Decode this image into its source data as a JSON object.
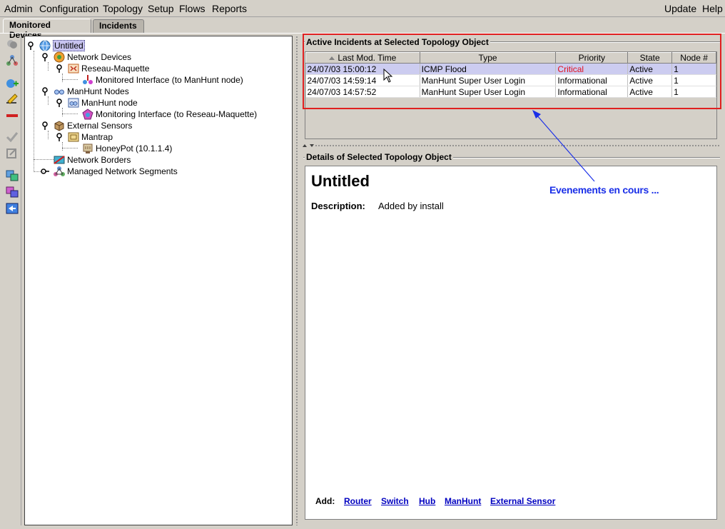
{
  "menubar": {
    "items": [
      "Admin",
      "Configuration",
      "Topology",
      "Setup",
      "Flows",
      "Reports"
    ],
    "right_items": [
      "Update",
      "Help"
    ]
  },
  "tabs": [
    {
      "label": "Monitored Devices",
      "active": true
    },
    {
      "label": "Incidents",
      "active": false
    }
  ],
  "tree": {
    "root": "Untitled",
    "network_devices": "Network Devices",
    "reseau": "Reseau-Maquette",
    "monitored_interface": "Monitored Interface (to ManHunt node)",
    "manhunt_nodes": "ManHunt Nodes",
    "manhunt_node": "ManHunt node",
    "monitoring_interface": "Monitoring Interface (to Reseau-Maquette)",
    "external_sensors": "External Sensors",
    "mantrap": "Mantrap",
    "honeypot": "HoneyPot (10.1.1.4)",
    "network_borders": "Network Borders",
    "managed_segments": "Managed Network Segments"
  },
  "incidents": {
    "title": "Active Incidents at Selected Topology Object",
    "columns": [
      "Last Mod. Time",
      "Type",
      "Priority",
      "State",
      "Node #"
    ],
    "rows": [
      {
        "time": "24/07/03 15:00:12",
        "type": "ICMP Flood",
        "priority": "Critical",
        "state": "Active",
        "node": "1"
      },
      {
        "time": "24/07/03 14:59:14",
        "type": "ManHunt Super User Login",
        "priority": "Informational",
        "state": "Active",
        "node": "1"
      },
      {
        "time": "24/07/03 14:57:52",
        "type": "ManHunt Super User Login",
        "priority": "Informational",
        "state": "Active",
        "node": "1"
      }
    ]
  },
  "details": {
    "title": "Details of Selected Topology Object",
    "object_name": "Untitled",
    "description_label": "Description:",
    "description_value": "Added by install",
    "add_label": "Add:",
    "add_links": [
      "Router",
      "Switch",
      "Hub",
      "ManHunt",
      "External Sensor"
    ]
  },
  "annotation": {
    "text": "Evenements en cours ..."
  },
  "colors": {
    "critical": "#e01020",
    "annotation": "#1a2fe8",
    "highlight_box": "#e02020",
    "link": "#0000c0"
  }
}
